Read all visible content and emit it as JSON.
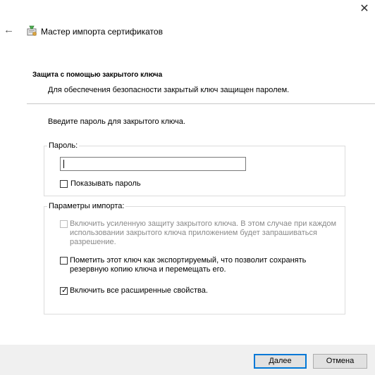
{
  "window": {
    "close_glyph": "✕",
    "back_glyph": "←",
    "title": "Мастер импорта сертификатов",
    "title_icon": "certificate-wizard-icon"
  },
  "header": {
    "title": "Защита с помощью закрытого ключа",
    "subtitle": "Для обеспечения безопасности закрытый ключ защищен паролем."
  },
  "main": {
    "intro": "Введите пароль для закрытого ключа.",
    "password_group": {
      "legend": "Пароль:",
      "value": "",
      "show_password_label": "Показывать пароль",
      "show_password_checked": false
    },
    "import_group": {
      "legend": "Параметры импорта:",
      "options": [
        {
          "label_lines": [
            "Включить усиленную защиту закрытого ключа. В этом случае при каждом",
            "использовании закрытого ключа приложением будет запрашиваться",
            "разрешение."
          ],
          "checked": false,
          "enabled": false
        },
        {
          "label_lines": [
            "Пометить этот ключ как экспортируемый, что позволит сохранять",
            "резервную копию ключа и перемещать его."
          ],
          "checked": false,
          "enabled": true
        },
        {
          "label_lines": [
            "Включить все расширенные свойства."
          ],
          "checked": true,
          "enabled": true
        }
      ]
    }
  },
  "footer": {
    "next_label": "Далее",
    "cancel_label": "Отмена"
  },
  "colors": {
    "accent": "#0078d7",
    "footer_bg": "#f0f0f0"
  }
}
